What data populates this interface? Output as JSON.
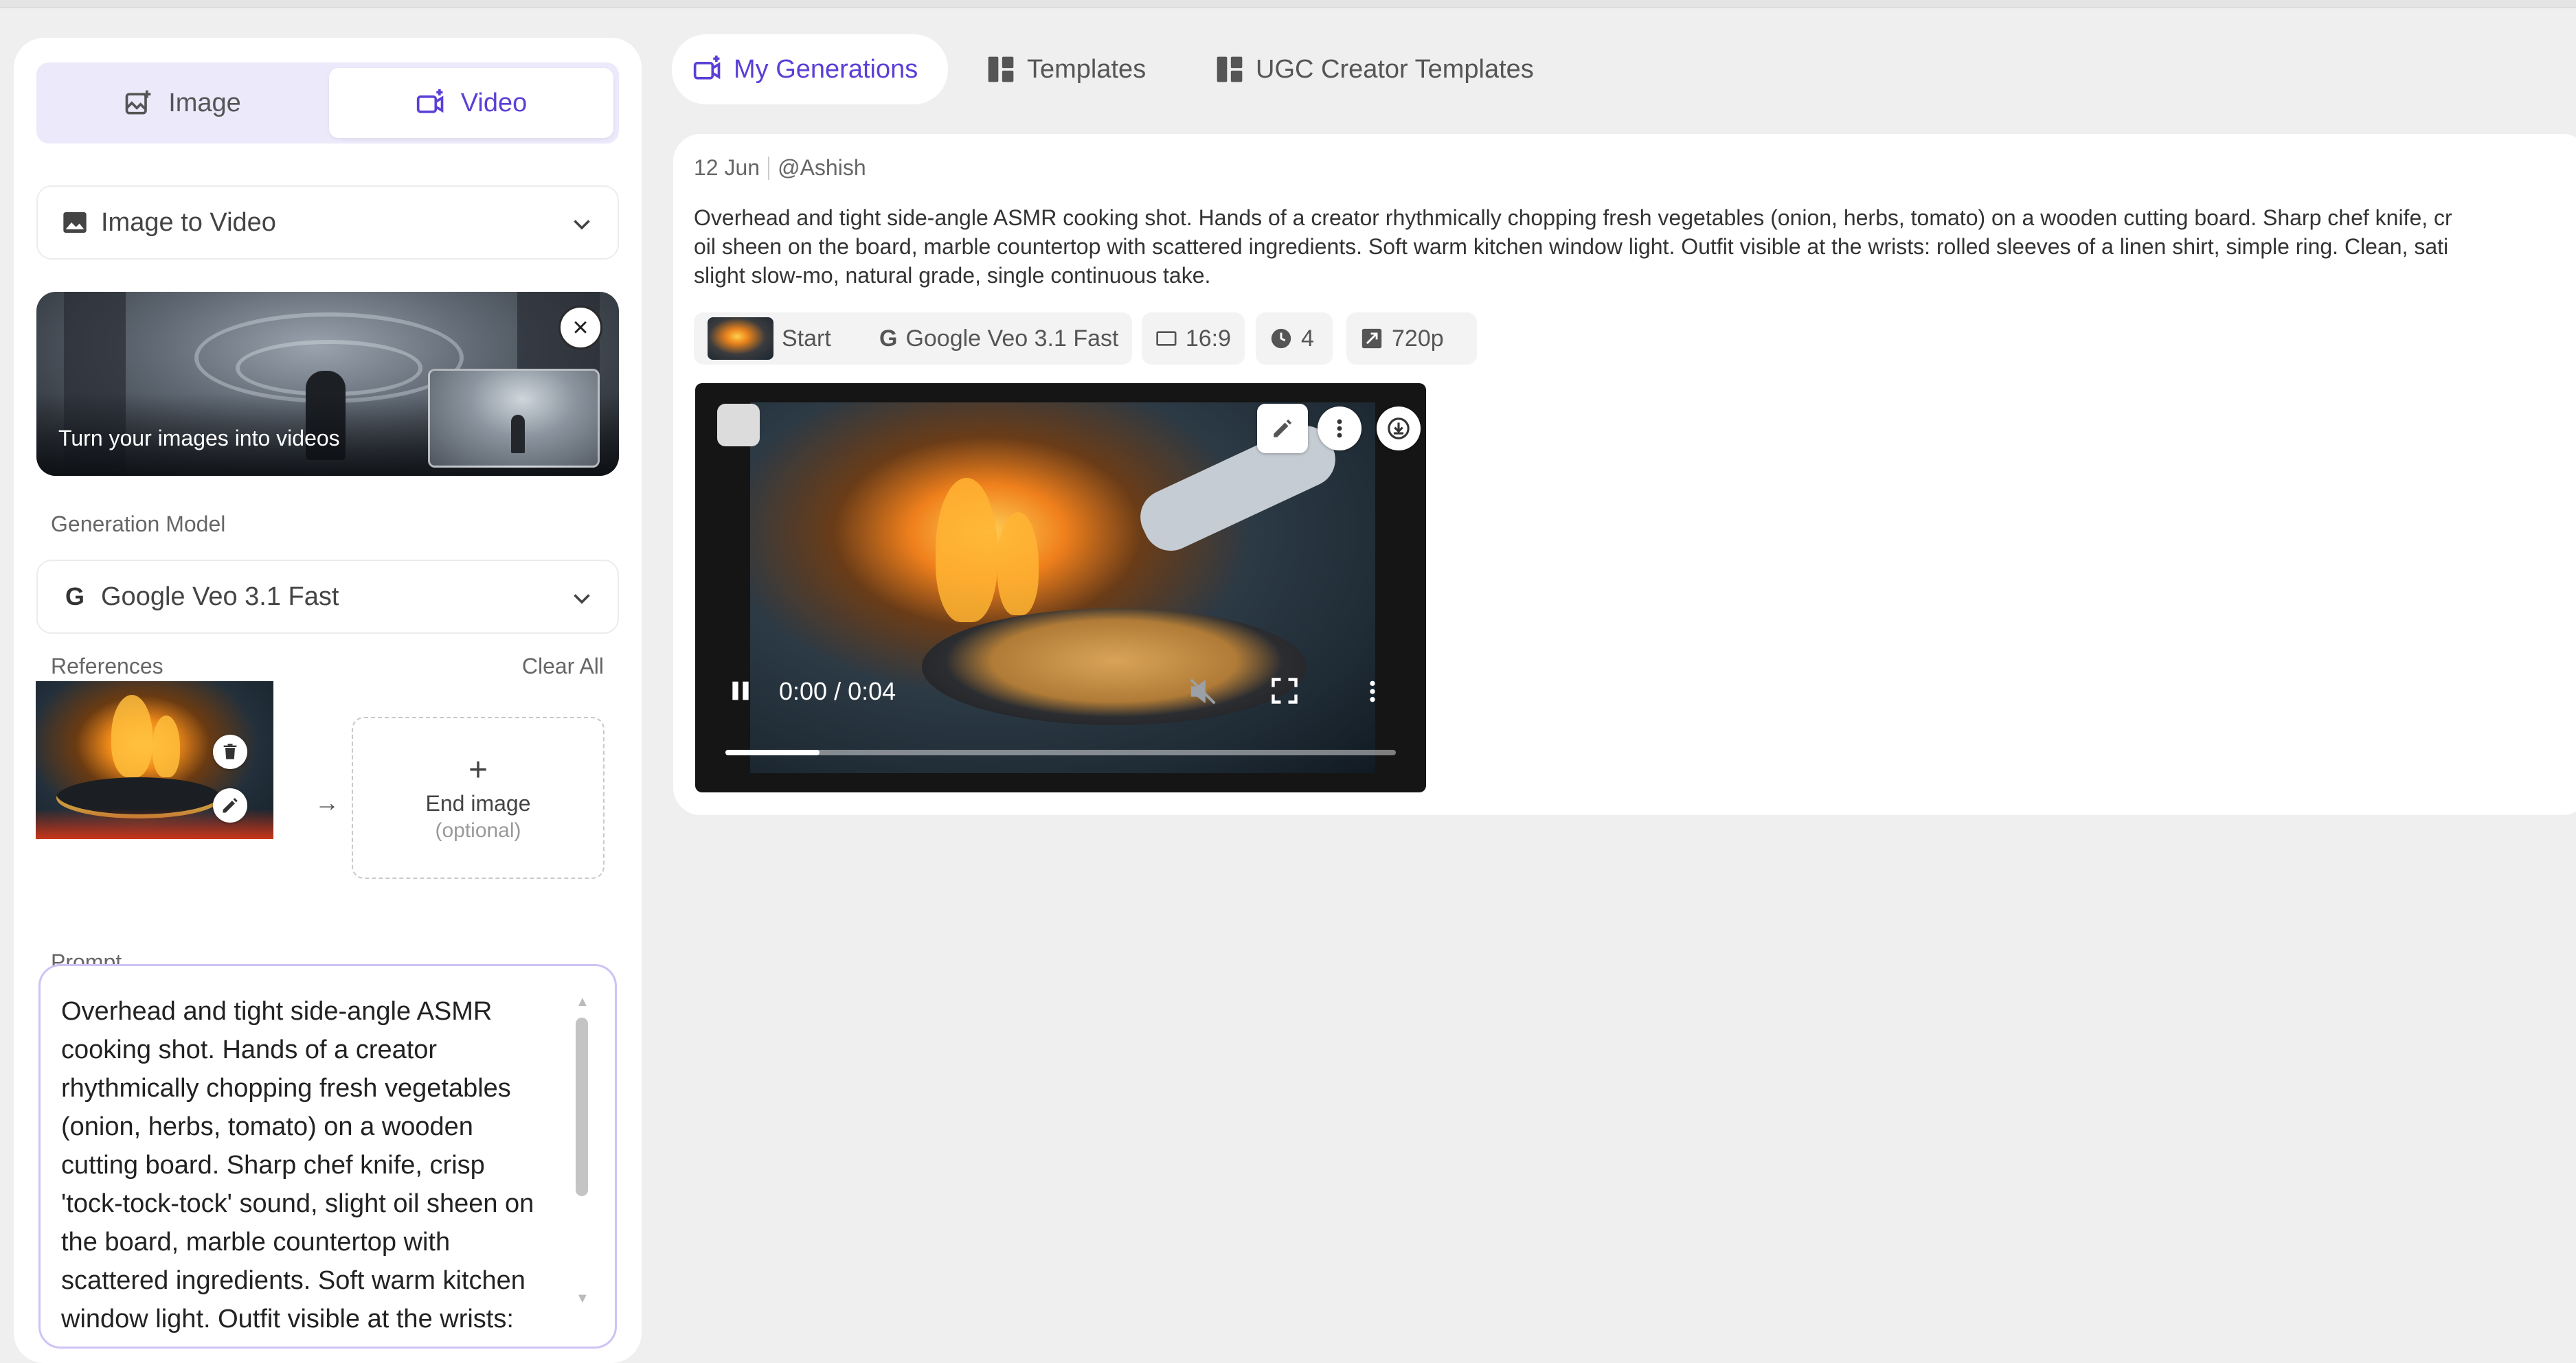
{
  "mode": {
    "image_label": "Image",
    "video_label": "Video",
    "active": "Video"
  },
  "type_select": {
    "value": "Image to Video",
    "icon": "image-icon"
  },
  "banner": {
    "caption": "Turn your images into videos"
  },
  "model": {
    "label": "Generation Model",
    "value": "Google Veo 3.1 Fast",
    "icon": "G"
  },
  "references": {
    "label": "References",
    "clear_label": "Clear All",
    "end_image_label": "End image",
    "end_image_hint": "(optional)"
  },
  "prompt": {
    "label": "Prompt",
    "text": "Overhead and tight side-angle ASMR cooking shot. Hands of a creator rhythmically chopping fresh vegetables (onion, herbs, tomato) on a wooden cutting board. Sharp chef knife, crisp 'tock-tock-tock' sound, slight oil sheen on the board, marble countertop with scattered ingredients. Soft warm kitchen window light. Outfit visible at the wrists:"
  },
  "tabs": [
    {
      "label": "My Generations",
      "active": true
    },
    {
      "label": "Templates",
      "active": false
    },
    {
      "label": "UGC Creator Templates",
      "active": false
    }
  ],
  "generation": {
    "date": "12 Jun",
    "user": "@Ashish",
    "description_lines": [
      "Overhead and tight side-angle ASMR cooking shot. Hands of a creator rhythmically chopping fresh vegetables (onion, herbs, tomato) on a wooden cutting board. Sharp chef knife, cr",
      "oil sheen on the board, marble countertop with scattered ingredients. Soft warm kitchen window light. Outfit visible at the wrists: rolled sleeves of a linen shirt, simple ring. Clean, sati",
      "slight slow-mo, natural grade, single continuous take."
    ],
    "chips": {
      "start": "Start",
      "model": "Google Veo 3.1 Fast",
      "ratio": "16:9",
      "duration": "4",
      "resolution": "720p"
    },
    "video": {
      "time": "0:00 / 0:04",
      "progress": 0.14
    }
  },
  "colors": {
    "accent": "#5b3fd6",
    "accent_soft": "#ece9fb",
    "background": "#efefef"
  }
}
